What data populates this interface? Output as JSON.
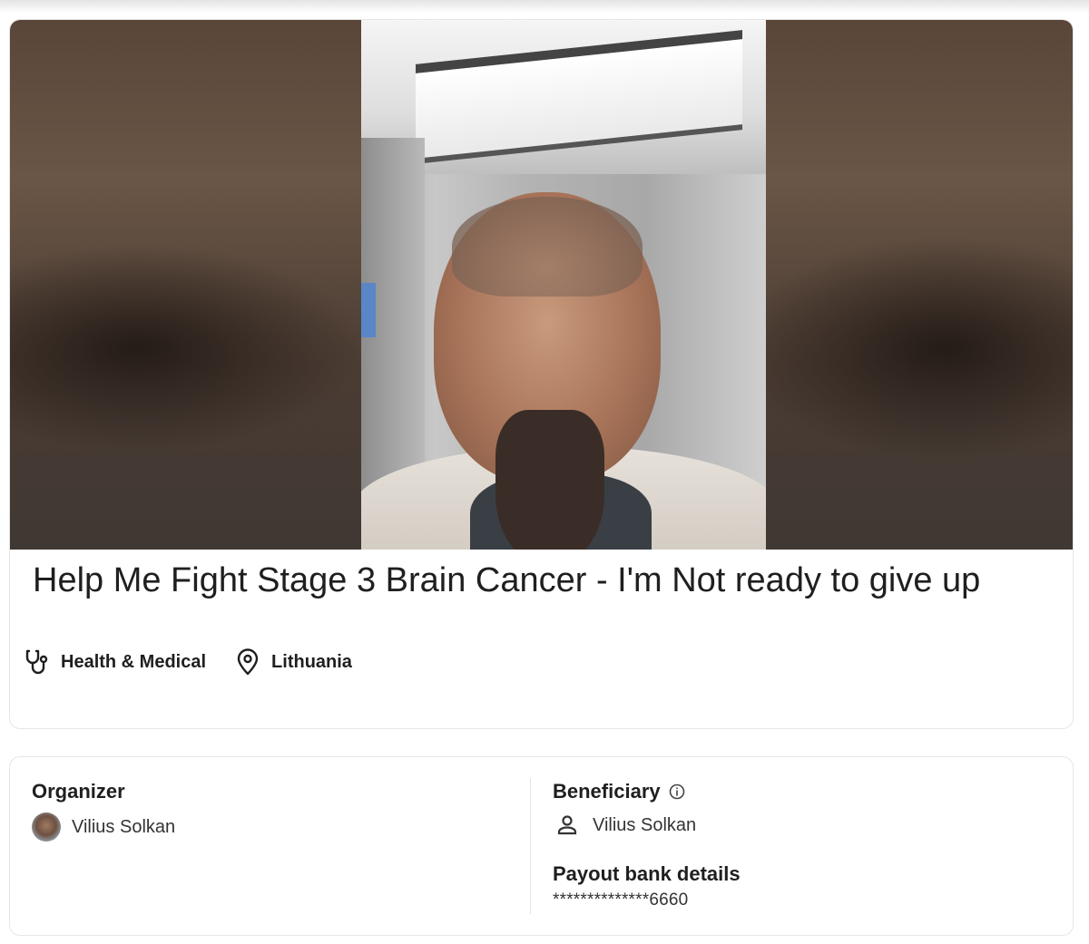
{
  "campaign": {
    "title": "Help Me Fight Stage 3 Brain Cancer - I'm Not ready to give up",
    "category": {
      "label": "Health & Medical",
      "icon": "stethoscope-icon"
    },
    "location": {
      "label": "Lithuania",
      "icon": "location-pin-icon"
    }
  },
  "organizer": {
    "heading": "Organizer",
    "name": "Vilius Solkan"
  },
  "beneficiary": {
    "heading": "Beneficiary",
    "info_icon": "info-icon",
    "name": "Vilius Solkan",
    "person_icon": "person-icon"
  },
  "payout": {
    "heading": "Payout bank details",
    "value": "**************6660"
  }
}
